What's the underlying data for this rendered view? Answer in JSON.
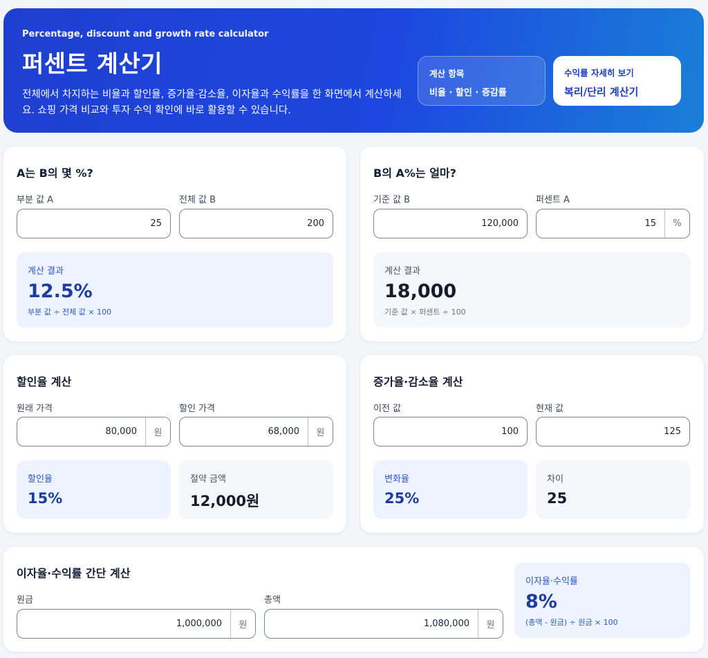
{
  "hero": {
    "subtitle": "Percentage, discount and growth rate calculator",
    "title": "퍼센트 계산기",
    "description": "전체에서 차지하는 비율과 할인율, 증가율·감소율, 이자율과 수익률을 한 화면에서 계산하세요. 쇼핑 가격 비교와 투자 수익 확인에 바로 활용할 수 있습니다.",
    "chip_items": {
      "label": "계산 항목",
      "value": "비율 · 할인 · 증감률"
    },
    "chip_link": {
      "label": "수익률 자세히 보기",
      "value": "복리/단리 계산기"
    }
  },
  "ratio_card": {
    "title": "A는 B의 몇 %?",
    "field_a_label": "부분 값 A",
    "field_a_value": "25",
    "field_b_label": "전체 값 B",
    "field_b_value": "200",
    "result_label": "계산 결과",
    "result_value": "12.5%",
    "result_formula": "부분 값 ÷ 전체 값 × 100"
  },
  "portion_card": {
    "title": "B의 A%는 얼마?",
    "field_b_label": "기준 값 B",
    "field_b_value": "120,000",
    "field_a_label": "퍼센트 A",
    "field_a_value": "15",
    "field_a_unit": "%",
    "result_label": "계산 결과",
    "result_value": "18,000",
    "result_formula": "기준 값 × 퍼센트 ÷ 100"
  },
  "discount_card": {
    "title": "할인율 계산",
    "original_label": "원래 가격",
    "original_value": "80,000",
    "original_unit": "원",
    "sale_label": "할인 가격",
    "sale_value": "68,000",
    "sale_unit": "원",
    "rate_label": "할인율",
    "rate_value": "15%",
    "saving_label": "절약 금액",
    "saving_value": "12,000원"
  },
  "change_card": {
    "title": "증가율·감소율 계산",
    "prev_label": "이전 값",
    "prev_value": "100",
    "curr_label": "현재 값",
    "curr_value": "125",
    "rate_label": "변화율",
    "rate_value": "25%",
    "diff_label": "차이",
    "diff_value": "25"
  },
  "interest_card": {
    "title": "이자율·수익률 간단 계산",
    "principal_label": "원금",
    "principal_value": "1,000,000",
    "principal_unit": "원",
    "total_label": "총액",
    "total_value": "1,080,000",
    "total_unit": "원",
    "result_label": "이자율·수익률",
    "result_value": "8%",
    "result_formula": "(총액 - 원금) ÷ 원금 × 100"
  }
}
